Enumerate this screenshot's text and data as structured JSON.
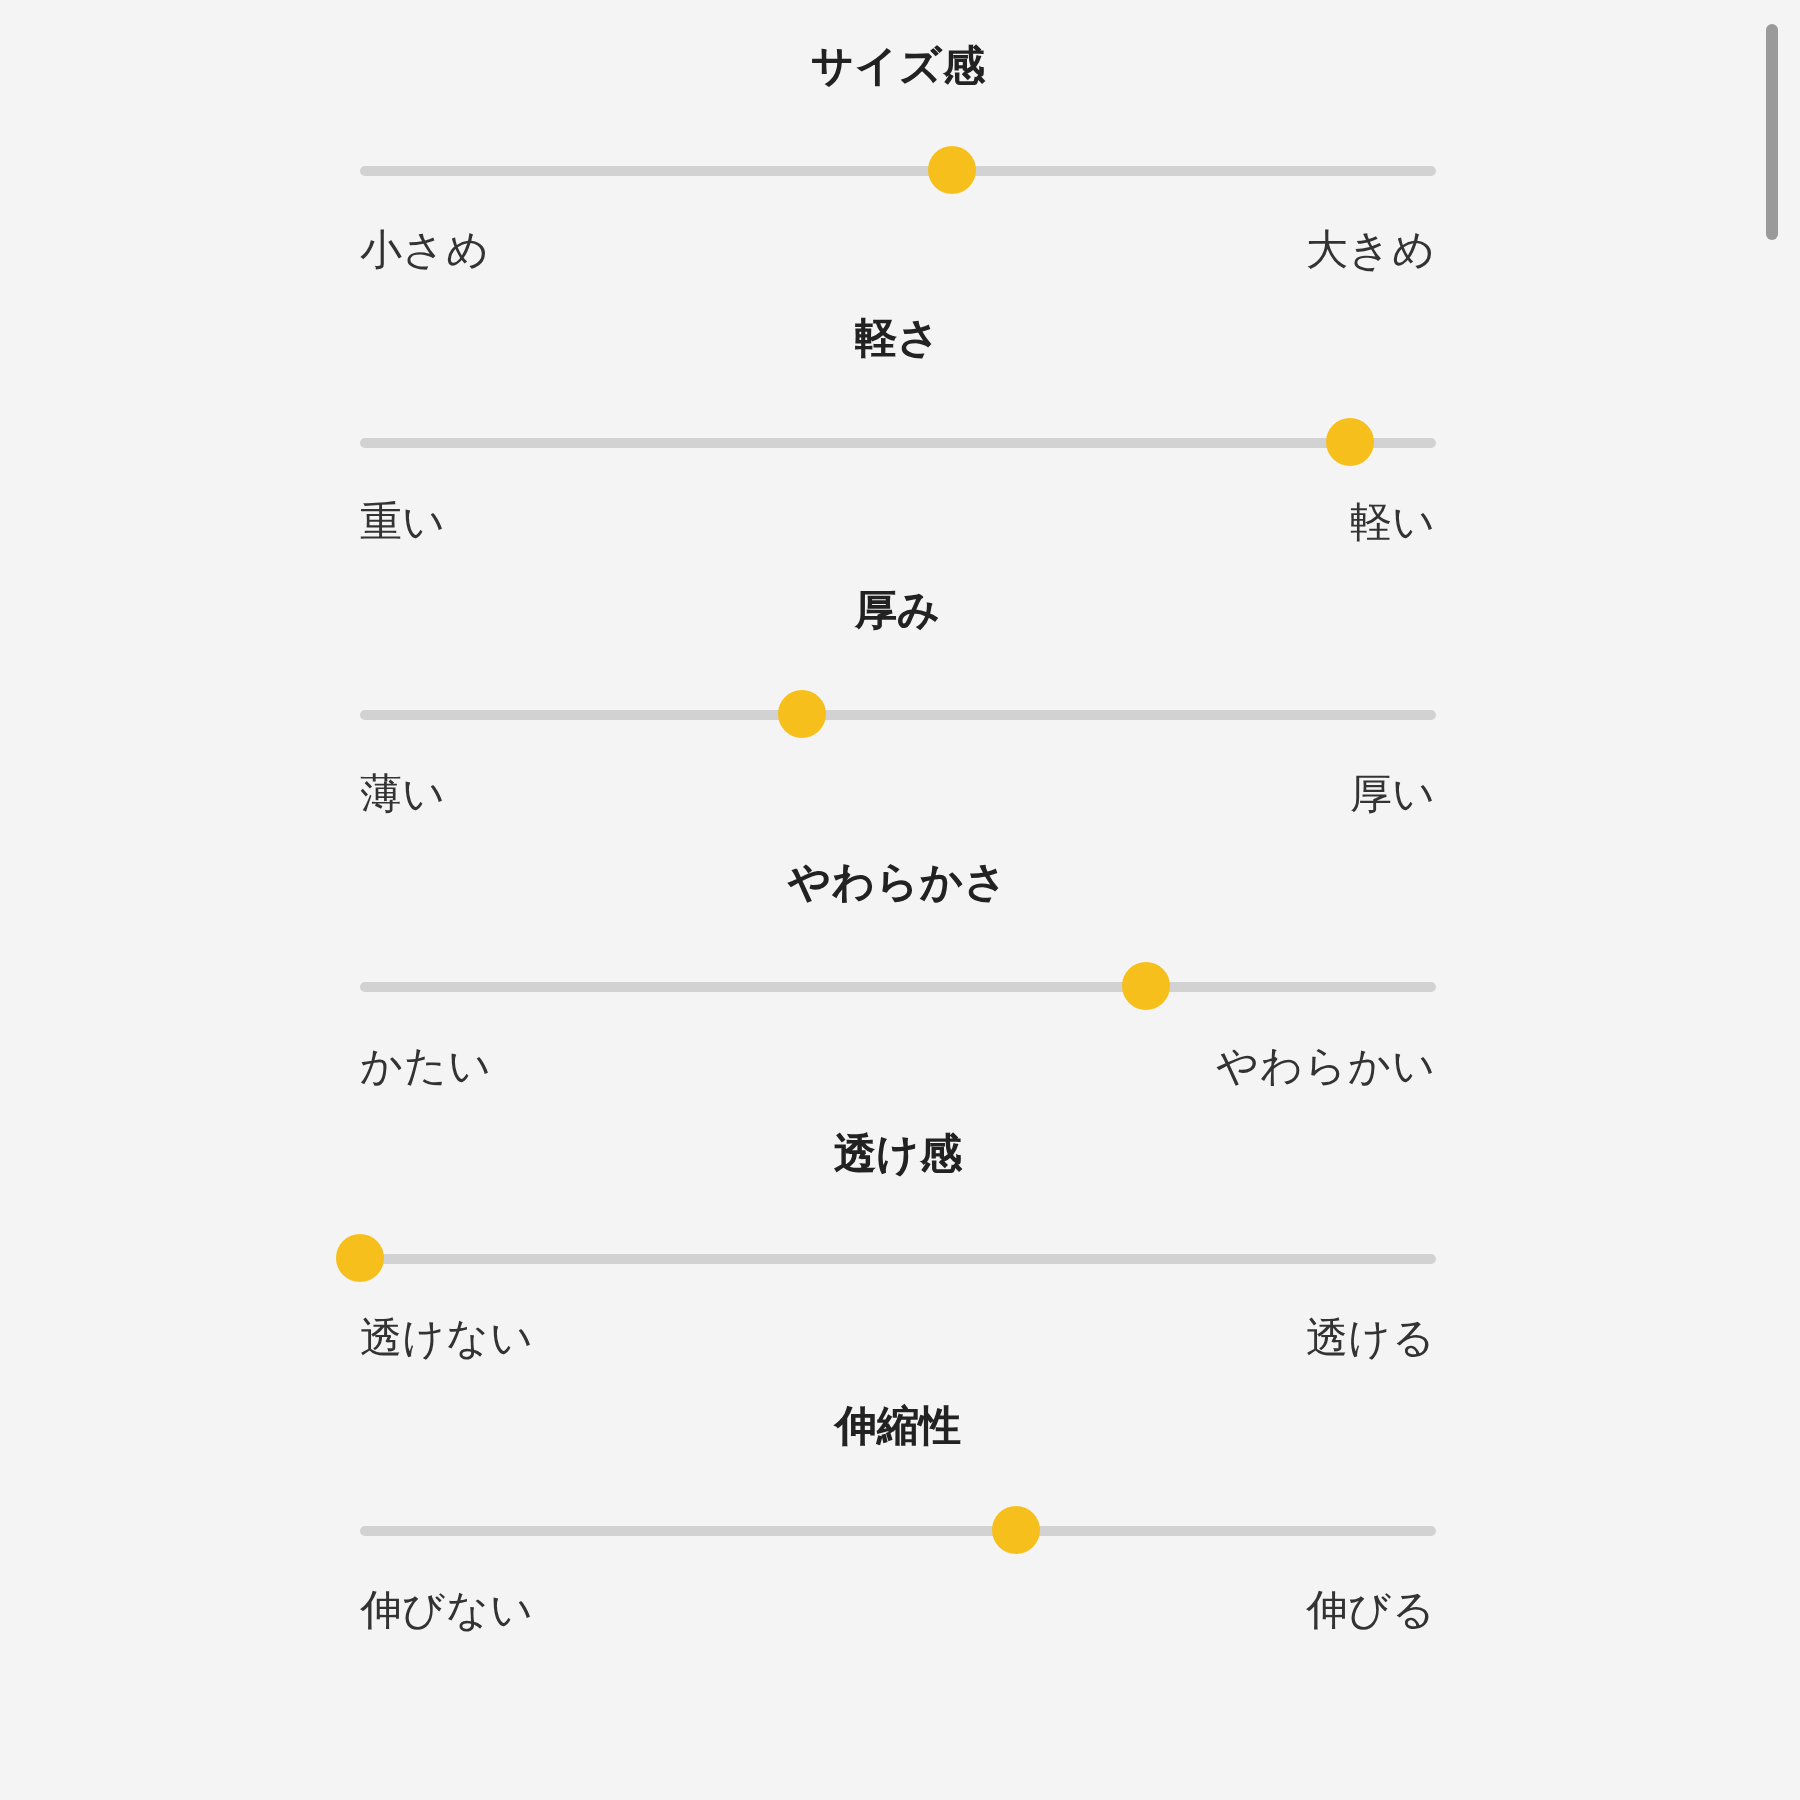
{
  "sliders": [
    {
      "title": "サイズ感",
      "level": 0.55,
      "min_label": "小さめ",
      "max_label": "大きめ"
    },
    {
      "title": "軽さ",
      "level": 0.92,
      "min_label": "重い",
      "max_label": "軽い"
    },
    {
      "title": "厚み",
      "level": 0.41,
      "min_label": "薄い",
      "max_label": "厚い"
    },
    {
      "title": "やわらかさ",
      "level": 0.73,
      "min_label": "かたい",
      "max_label": "やわらかい"
    },
    {
      "title": "透け感",
      "level": 0,
      "min_label": "透けない",
      "max_label": "透ける"
    },
    {
      "title": "伸縮性",
      "level": 0.61,
      "min_label": "伸びない",
      "max_label": "伸びる"
    }
  ]
}
